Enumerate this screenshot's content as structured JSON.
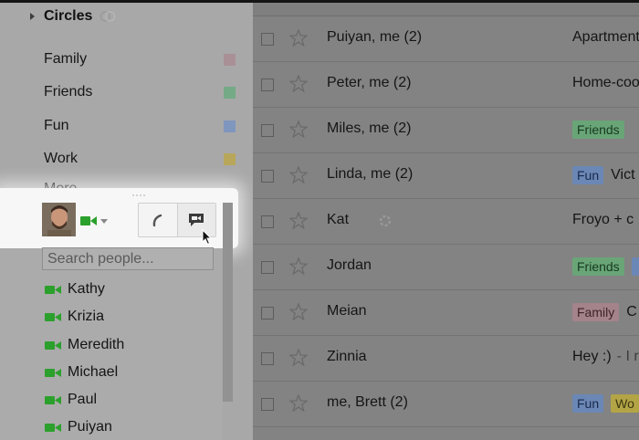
{
  "sidebar": {
    "circles_title": "Circles",
    "circles": [
      {
        "label": "Family",
        "color": "#a98f96"
      },
      {
        "label": "Friends",
        "color": "#74aa85"
      },
      {
        "label": "Fun",
        "color": "#7f96bf"
      },
      {
        "label": "Work",
        "color": "#b8a75a"
      }
    ],
    "more_label": "More –"
  },
  "chat": {
    "search_placeholder": "Search people...",
    "video_icon_color": "#2ca02c",
    "contacts": [
      "Kathy",
      "Krizia",
      "Meredith",
      "Michael",
      "Paul",
      "Puiyan"
    ]
  },
  "mail": {
    "rows": [
      {
        "sender": "Puiyan, me (2)",
        "labels": [],
        "subject": "Apartment"
      },
      {
        "sender": "Peter, me (2)",
        "labels": [],
        "subject": "Home-coo"
      },
      {
        "sender": "Miles, me (2)",
        "labels": [
          "Friends"
        ],
        "subject": ""
      },
      {
        "sender": "Linda, me (2)",
        "labels": [
          "Fun"
        ],
        "subject": "Vict"
      },
      {
        "sender": "Kat",
        "labels": [],
        "subject": "Froyo + c"
      },
      {
        "sender": "Jordan",
        "labels": [
          "Friends",
          ""
        ],
        "subject": ""
      },
      {
        "sender": "Meian",
        "labels": [
          "Family"
        ],
        "subject": "C"
      },
      {
        "sender": "Zinnia",
        "labels": [],
        "subject": "Hey :)",
        "snippet": "- I r"
      },
      {
        "sender": "me, Brett (2)",
        "labels": [
          "Fun",
          "Wo"
        ],
        "subject": ""
      }
    ]
  }
}
